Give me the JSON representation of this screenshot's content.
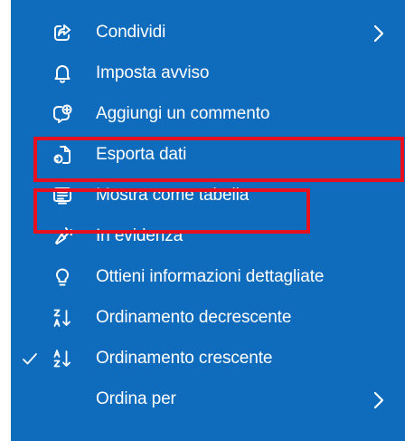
{
  "colors": {
    "menu_background": "#0f6cbd",
    "text": "#ffffff",
    "highlight_border": "#e8101e"
  },
  "menu": {
    "items": [
      {
        "label": "Condividi",
        "icon": "share-icon",
        "has_submenu": true,
        "checked": false
      },
      {
        "label": "Imposta avviso",
        "icon": "bell-icon",
        "has_submenu": false,
        "checked": false
      },
      {
        "label": "Aggiungi un commento",
        "icon": "comment-add-icon",
        "has_submenu": false,
        "checked": false
      },
      {
        "label": "Esporta dati",
        "icon": "export-data-icon",
        "has_submenu": false,
        "checked": false,
        "highlighted": true
      },
      {
        "label": "Mostra come tabella",
        "icon": "table-view-icon",
        "has_submenu": false,
        "checked": false,
        "highlighted": true
      },
      {
        "label": "In evidenza",
        "icon": "spotlight-icon",
        "has_submenu": false,
        "checked": false
      },
      {
        "label": "Ottieni informazioni dettagliate",
        "icon": "lightbulb-icon",
        "has_submenu": false,
        "checked": false
      },
      {
        "label": "Ordinamento decrescente",
        "icon": "sort-descending-icon",
        "has_submenu": false,
        "checked": false
      },
      {
        "label": "Ordinamento crescente",
        "icon": "sort-ascending-icon",
        "has_submenu": false,
        "checked": true
      },
      {
        "label": "Ordina per",
        "icon": "",
        "has_submenu": true,
        "checked": false
      }
    ]
  }
}
